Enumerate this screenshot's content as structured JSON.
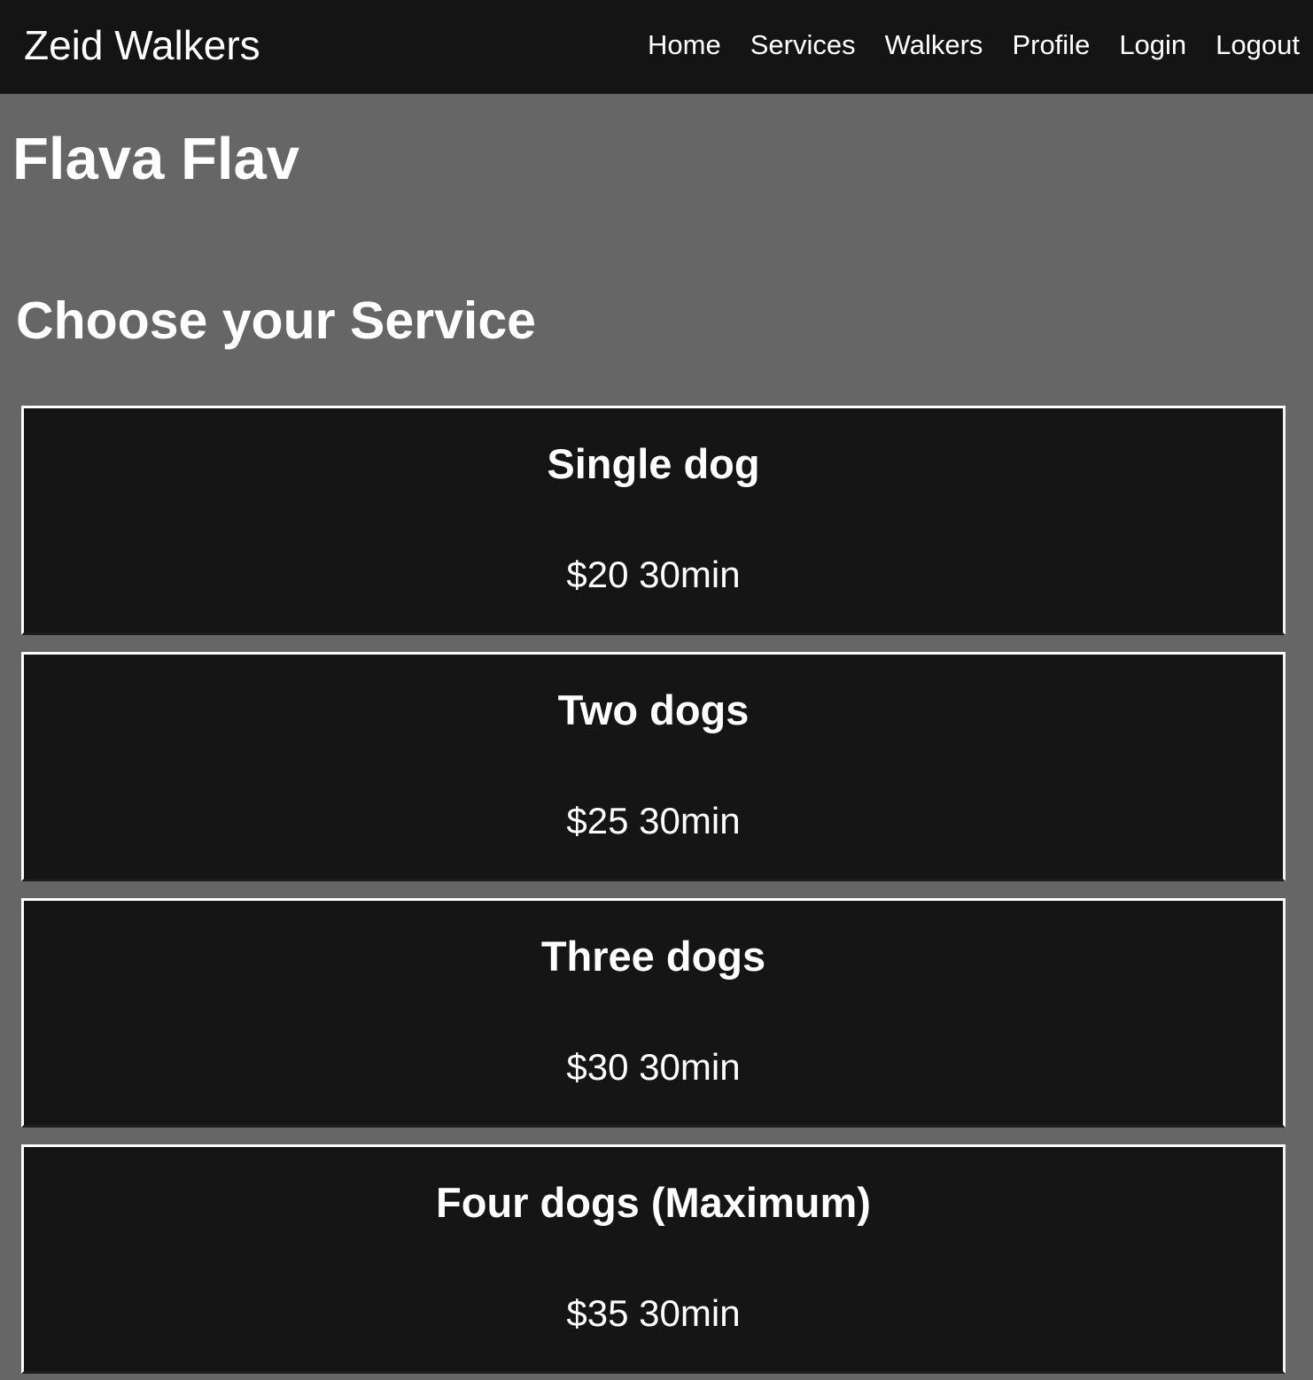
{
  "navbar": {
    "brand": "Zeid Walkers",
    "links": [
      "Home",
      "Services",
      "Walkers",
      "Profile",
      "Login",
      "Logout"
    ]
  },
  "walker": {
    "name": "Flava Flav"
  },
  "section": {
    "title": "Choose your Service"
  },
  "services": [
    {
      "name": "Single dog",
      "price": "$20 30min"
    },
    {
      "name": "Two dogs",
      "price": "$25 30min"
    },
    {
      "name": "Three dogs",
      "price": "$30 30min"
    },
    {
      "name": "Four dogs (Maximum)",
      "price": "$35 30min"
    }
  ],
  "colors": {
    "page_background": "#666666",
    "navbar_background": "#141414",
    "card_background": "#151515",
    "text": "#ffffff"
  }
}
